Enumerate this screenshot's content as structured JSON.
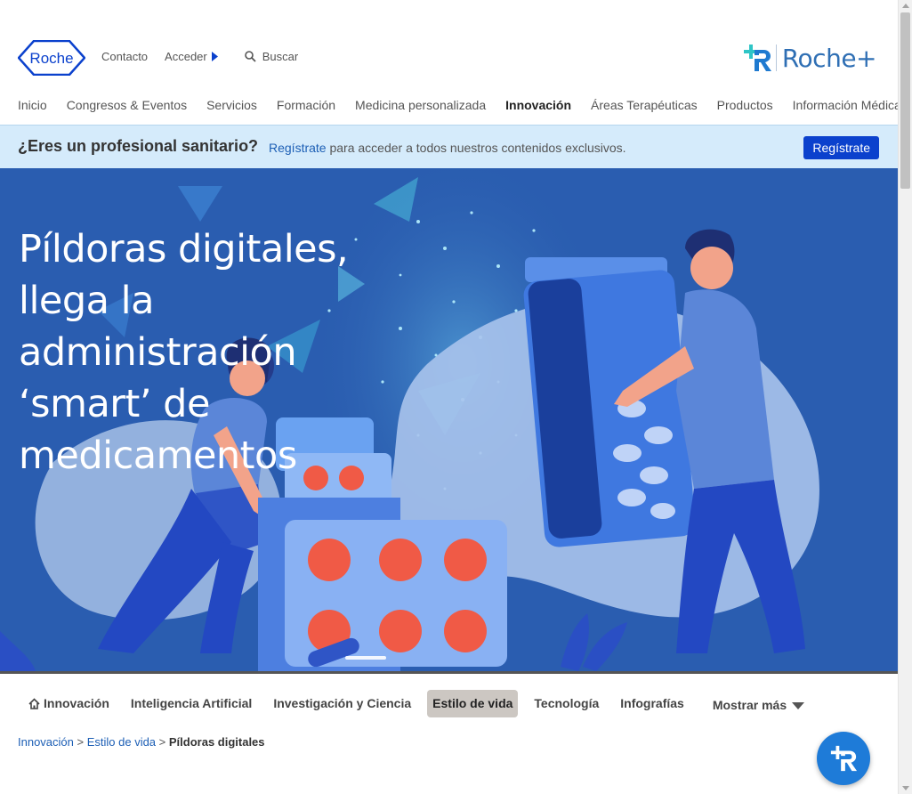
{
  "brand": {
    "logo_text": "Roche",
    "rocheplus_text": "Roche+"
  },
  "top_links": {
    "contact": "Contacto",
    "login": "Acceder",
    "search": "Buscar"
  },
  "main_nav": [
    {
      "label": "Inicio"
    },
    {
      "label": "Congresos & Eventos"
    },
    {
      "label": "Servicios"
    },
    {
      "label": "Formación"
    },
    {
      "label": "Medicina personalizada"
    },
    {
      "label": "Innovación",
      "active": true
    },
    {
      "label": "Áreas Terapéuticas"
    },
    {
      "label": "Productos"
    },
    {
      "label": "Información Médica"
    }
  ],
  "pro_banner": {
    "question": "¿Eres un profesional sanitario?",
    "link": "Regístrate",
    "message": " para acceder a todos nuestros contenidos exclusivos.",
    "button": "Regístrate"
  },
  "hero": {
    "title": "Píldoras digitales, llega la administración ‘smart’ de medicamentos"
  },
  "tabs": [
    {
      "label": "Innovación",
      "icon": "home-icon"
    },
    {
      "label": "Inteligencia Artificial"
    },
    {
      "label": "Investigación y Ciencia"
    },
    {
      "label": "Estilo de vida",
      "active": true
    },
    {
      "label": "Tecnología"
    },
    {
      "label": "Infografías"
    },
    {
      "label": "Mostrar más",
      "icon": "caret-down-icon"
    }
  ],
  "breadcrumb": {
    "items": [
      "Innovación",
      "Estilo de vida"
    ],
    "separator": " > ",
    "current": "Píldoras digitales"
  },
  "colors": {
    "primary_blue": "#0b41cd",
    "banner_bg": "#d5ebfb",
    "hero_bg": "#2a5db0",
    "link": "#1d5fb5",
    "active_tab": "#ccc7c2"
  }
}
